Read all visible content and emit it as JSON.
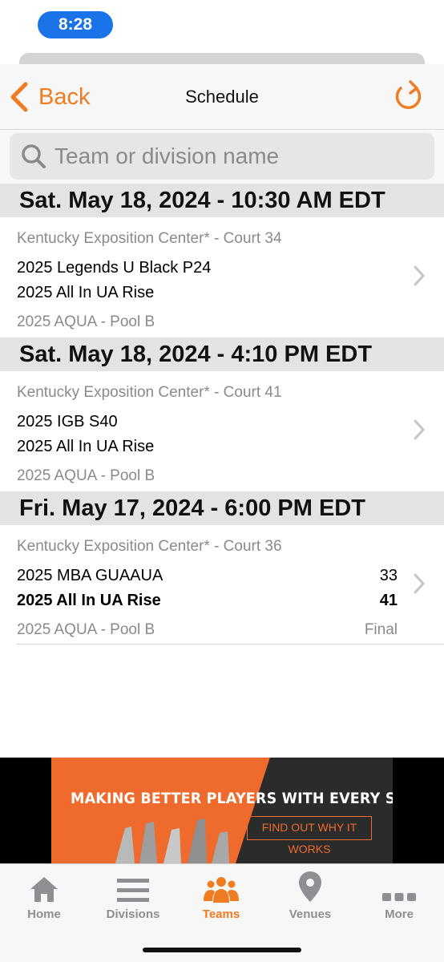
{
  "status_bar": {
    "time": "8:28"
  },
  "nav": {
    "back_label": "Back",
    "title": "Schedule"
  },
  "search": {
    "placeholder": "Team or division name",
    "value": ""
  },
  "sections": [
    {
      "header": "Sat. May 18, 2024 - 10:30 AM EDT",
      "game": {
        "venue": "Kentucky Exposition Center* - Court 34",
        "team1": "2025 Legends U Black P24",
        "team2": "2025 All In UA Rise",
        "division": "2025 AQUA - Pool B"
      }
    },
    {
      "header": "Sat. May 18, 2024 - 4:10 PM EDT",
      "game": {
        "venue": "Kentucky Exposition Center* - Court 41",
        "team1": "2025 IGB S40",
        "team2": "2025 All In UA Rise",
        "division": "2025 AQUA - Pool B"
      }
    },
    {
      "header": "Fri. May 17, 2024 - 6:00 PM EDT",
      "game": {
        "venue": "Kentucky Exposition Center* - Court 36",
        "team1": "2025 MBA GUAAUA",
        "team1_score": "33",
        "team2": "2025 All In UA Rise",
        "team2_score": "41",
        "division": "2025 AQUA - Pool B",
        "status": "Final"
      }
    }
  ],
  "ad": {
    "headline": "MAKING BETTER PLAYERS WITH EVERY SHOT",
    "cta": "FIND OUT WHY IT WORKS"
  },
  "tabs": [
    {
      "label": "Home",
      "icon": "home-icon"
    },
    {
      "label": "Divisions",
      "icon": "list-icon"
    },
    {
      "label": "Teams",
      "icon": "people-icon",
      "active": true
    },
    {
      "label": "Venues",
      "icon": "map-pin-icon"
    },
    {
      "label": "More",
      "icon": "ellipsis-icon"
    }
  ],
  "colors": {
    "accent": "#f07c22",
    "header_bg": "#e3e3e3",
    "ad_orange": "#ee6a2d",
    "status_pill": "#1a73e8"
  }
}
